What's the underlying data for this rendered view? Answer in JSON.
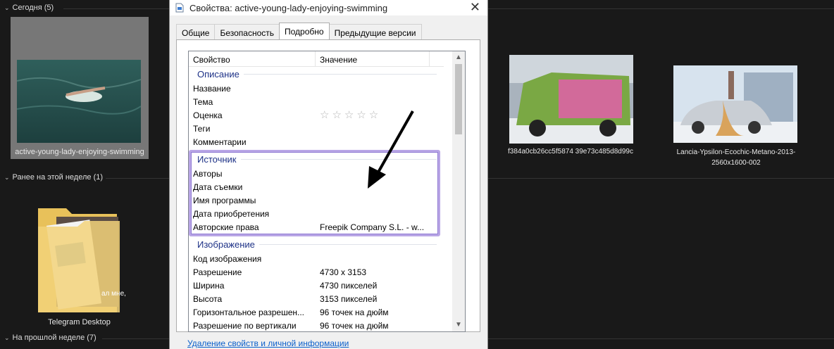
{
  "explorer": {
    "groups": [
      {
        "label": "Сегодня (5)"
      },
      {
        "label": "Ранее на этой неделе (1)"
      },
      {
        "label": "На прошлой неделе (7)"
      }
    ],
    "items": [
      {
        "name": "active-young-lady-enjoying-swimming"
      },
      {
        "name": "Telegram Desktop"
      },
      {
        "name": "f384a0cb26cc5f5874 39e73c485d8d99c"
      },
      {
        "name": "Lancia-Ypsilon-Ecochic-Metano-2013-2560x1600-002"
      }
    ],
    "folder_overlay_text": "ал мне,"
  },
  "dialog": {
    "title": "Свойства: active-young-lady-enjoying-swimming",
    "close": "✕",
    "tabs": [
      "Общие",
      "Безопасность",
      "Подробно",
      "Предыдущие версии"
    ],
    "active_tab": "Подробно",
    "columns": {
      "property": "Свойство",
      "value": "Значение"
    },
    "sections": {
      "description": "Описание",
      "source": "Источник",
      "image": "Изображение"
    },
    "rows": {
      "name": {
        "p": "Название",
        "v": ""
      },
      "subject": {
        "p": "Тема",
        "v": ""
      },
      "rating": {
        "p": "Оценка",
        "v": "☆☆☆☆☆"
      },
      "tags": {
        "p": "Теги",
        "v": ""
      },
      "comments": {
        "p": "Комментарии",
        "v": ""
      },
      "authors": {
        "p": "Авторы",
        "v": ""
      },
      "date_taken": {
        "p": "Дата съемки",
        "v": ""
      },
      "program": {
        "p": "Имя программы",
        "v": ""
      },
      "date_acquired": {
        "p": "Дата приобретения",
        "v": ""
      },
      "copyright": {
        "p": "Авторские права",
        "v": "Freepik Company S.L. - w..."
      },
      "image_id": {
        "p": "Код изображения",
        "v": ""
      },
      "dimensions": {
        "p": "Разрешение",
        "v": "4730 x 3153"
      },
      "width": {
        "p": "Ширина",
        "v": "4730 пикселей"
      },
      "height": {
        "p": "Высота",
        "v": "3153 пикселей"
      },
      "hres": {
        "p": "Горизонтальное разрешен...",
        "v": "96 точек на дюйм"
      },
      "vres": {
        "p": "Разрешение по вертикали",
        "v": "96 точек на дюйм"
      }
    },
    "remove_link": "Удаление свойств и личной информации"
  },
  "icons": {
    "scroll_up": "chevron-up-icon",
    "scroll_down": "chevron-down-icon"
  },
  "colors": {
    "highlight_border": "#b9a6e6",
    "section_text": "#1e3287",
    "link": "#0a5fcb"
  }
}
